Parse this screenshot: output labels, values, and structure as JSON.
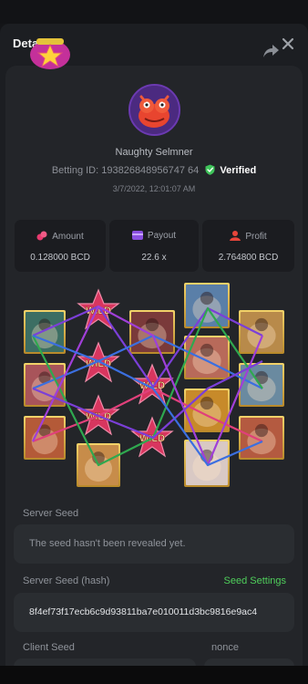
{
  "header": {
    "title": "Details"
  },
  "bet": {
    "username": "Naughty Selmner",
    "betting_id_label": "Betting ID:",
    "betting_id": "193826848956747 64",
    "verified_label": "Verified",
    "datetime": "3/7/2022, 12:01:07 AM"
  },
  "stats": [
    {
      "label": "Amount",
      "value": "0.128000 BCD",
      "icon": "coins-icon"
    },
    {
      "label": "Payout",
      "value": "22.6 x",
      "icon": "wallet-icon"
    },
    {
      "label": "Profit",
      "value": "2.764800 BCD",
      "icon": "profit-icon"
    }
  ],
  "slot": {
    "wild_label": "WILD",
    "line_colors": [
      "#7b3fd8",
      "#3b6fe0",
      "#e0407a",
      "#2fa84f",
      "#a03fd8"
    ]
  },
  "seeds": {
    "server_seed_label": "Server Seed",
    "server_seed_value": "The seed hasn't been revealed yet.",
    "server_hash_label": "Server Seed (hash)",
    "seed_settings_label": "Seed Settings",
    "server_hash_value": "8f4ef73f17ecb6c9d93811ba7e010011d3bc9816e9ac4",
    "client_seed_label": "Client Seed",
    "nonce_label": "nonce"
  },
  "colors": {
    "accent_green": "#4fcf5b",
    "background": "#1c1e22",
    "card": "#232529"
  }
}
